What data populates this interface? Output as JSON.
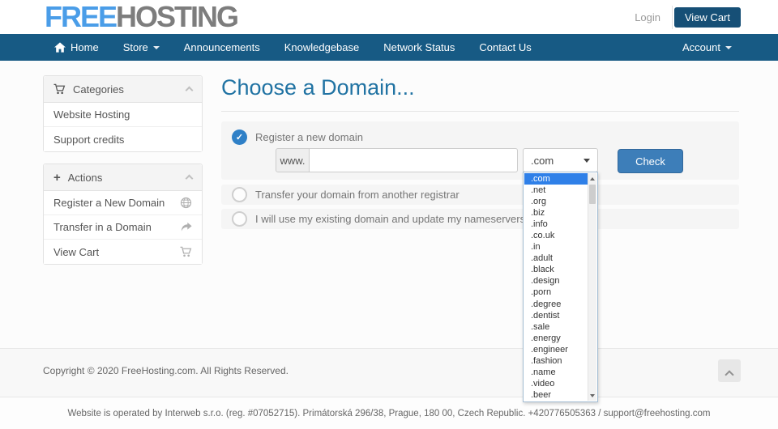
{
  "header": {
    "logo": {
      "free": "FREE",
      "hosting": "HOSTING"
    },
    "login_label": "Login",
    "view_cart_label": "View Cart"
  },
  "nav": {
    "items": [
      {
        "label": "Home",
        "icon": "home-icon"
      },
      {
        "label": "Store",
        "icon": "caret-down-icon"
      },
      {
        "label": "Announcements"
      },
      {
        "label": "Knowledgebase"
      },
      {
        "label": "Network Status"
      },
      {
        "label": "Contact Us"
      }
    ],
    "account": {
      "label": "Account",
      "icon": "caret-down-icon"
    }
  },
  "sidebar": {
    "categories": {
      "title": "Categories",
      "icon": "cart-icon",
      "items": [
        "Website Hosting",
        "Support credits"
      ]
    },
    "actions": {
      "title": "Actions",
      "icon": "plus-icon",
      "items": [
        {
          "label": "Register a New Domain",
          "icon": "globe-icon"
        },
        {
          "label": "Transfer in a Domain",
          "icon": "share-arrow-icon"
        },
        {
          "label": "View Cart",
          "icon": "cart-icon"
        }
      ]
    }
  },
  "main": {
    "title": "Choose a Domain...",
    "options": [
      {
        "label": "Register a new domain",
        "checked": true
      },
      {
        "label": "Transfer your domain from another registrar",
        "checked": false
      },
      {
        "label": "I will use my existing domain and update my nameservers",
        "checked": false
      }
    ],
    "domain_form": {
      "www_prefix": "www.",
      "domain_value": "",
      "selected_tld": ".com",
      "check_label": "Check",
      "tld_options": [
        {
          "label": ".com",
          "selected": true
        },
        {
          "label": ".net"
        },
        {
          "label": ".org"
        },
        {
          "label": ".biz"
        },
        {
          "label": ".info"
        },
        {
          "label": ".co.uk"
        },
        {
          "label": ".in"
        },
        {
          "label": ".adult"
        },
        {
          "label": ".black"
        },
        {
          "label": ".design"
        },
        {
          "label": ".porn"
        },
        {
          "label": ".degree"
        },
        {
          "label": ".dentist"
        },
        {
          "label": ".sale"
        },
        {
          "label": ".energy"
        },
        {
          "label": ".engineer"
        },
        {
          "label": ".fashion"
        },
        {
          "label": ".name"
        },
        {
          "label": ".video"
        },
        {
          "label": ".beer"
        }
      ]
    }
  },
  "footer": {
    "copyright": "Copyright © 2020 FreeHosting.com. All Rights Reserved.",
    "operator_line": "Website is operated by Interweb s.r.o. (reg. #07052715). Primátorská 296/38, Prague, 180 00, Czech Republic. +420776505363 / support@freehosting.com"
  },
  "colors": {
    "brand_blue": "#4a9de8",
    "brand_gray": "#7d7d7d",
    "nav_blue": "#175a84",
    "heading_blue": "#2173a3",
    "radio_checked_blue": "#2f80c7",
    "check_button_blue": "#3d7eb9",
    "view_cart_button_blue": "#164f76",
    "dropdown_highlight_blue": "#2f80e8"
  }
}
